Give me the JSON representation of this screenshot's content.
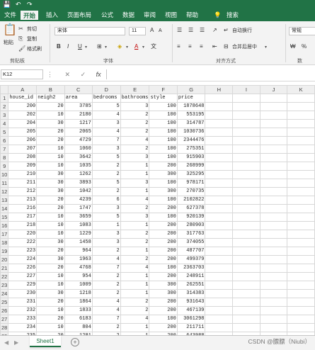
{
  "titlebar": {
    "save_icon": "💾",
    "undo_icon": "↶",
    "redo_icon": "↷"
  },
  "ribbon_tabs": [
    "文件",
    "开始",
    "插入",
    "页面布局",
    "公式",
    "数据",
    "审阅",
    "视图",
    "帮助"
  ],
  "active_tab": "开始",
  "tell_me": "搜索",
  "ribbon": {
    "clipboard": {
      "paste": "粘贴",
      "cut": "剪切",
      "copy": "复制",
      "format_painter": "格式刷",
      "label": "剪贴板"
    },
    "font": {
      "name": "宋体",
      "size": "11",
      "bold": "B",
      "italic": "I",
      "underline": "U",
      "label": "字体"
    },
    "alignment": {
      "wrap": "自动换行",
      "merge": "合并后居中",
      "label": "对齐方式"
    },
    "number": {
      "format": "常规",
      "label": "数"
    }
  },
  "formula_bar": {
    "name_box": "K12",
    "cancel": "✕",
    "enter": "✓",
    "fx": "fx",
    "value": ""
  },
  "columns": [
    "A",
    "B",
    "C",
    "D",
    "E",
    "F",
    "G",
    "H",
    "I",
    "J",
    "K"
  ],
  "header_row": [
    "house_id",
    "neigh2",
    "area",
    "bedrooms",
    "bathrooms",
    "style",
    "price"
  ],
  "rows": [
    [
      "200",
      "20",
      "3785",
      "5",
      "3",
      "100",
      "1878648"
    ],
    [
      "202",
      "10",
      "2180",
      "4",
      "2",
      "100",
      "553195"
    ],
    [
      "204",
      "30",
      "1217",
      "3",
      "2",
      "100",
      "314787"
    ],
    [
      "205",
      "20",
      "2065",
      "4",
      "2",
      "100",
      "1030736"
    ],
    [
      "206",
      "20",
      "4729",
      "7",
      "4",
      "100",
      "2344476"
    ],
    [
      "207",
      "10",
      "1060",
      "3",
      "2",
      "100",
      "275351"
    ],
    [
      "208",
      "10",
      "3642",
      "5",
      "3",
      "100",
      "915903"
    ],
    [
      "209",
      "10",
      "1035",
      "2",
      "1",
      "200",
      "268999"
    ],
    [
      "210",
      "30",
      "1262",
      "2",
      "1",
      "300",
      "325295"
    ],
    [
      "211",
      "30",
      "3893",
      "5",
      "3",
      "100",
      "978171"
    ],
    [
      "212",
      "30",
      "1042",
      "2",
      "1",
      "300",
      "270735"
    ],
    [
      "213",
      "20",
      "4239",
      "6",
      "4",
      "100",
      "2102822"
    ],
    [
      "216",
      "20",
      "1747",
      "3",
      "2",
      "200",
      "627378"
    ],
    [
      "217",
      "10",
      "3659",
      "5",
      "3",
      "100",
      "920139"
    ],
    [
      "218",
      "10",
      "1083",
      "1",
      "1",
      "200",
      "280903"
    ],
    [
      "220",
      "10",
      "1229",
      "3",
      "2",
      "200",
      "317763"
    ],
    [
      "222",
      "30",
      "1458",
      "3",
      "2",
      "200",
      "374055"
    ],
    [
      "223",
      "20",
      "964",
      "2",
      "1",
      "200",
      "487707"
    ],
    [
      "224",
      "30",
      "1963",
      "4",
      "2",
      "200",
      "499379"
    ],
    [
      "226",
      "20",
      "4768",
      "7",
      "4",
      "100",
      "2363703"
    ],
    [
      "227",
      "10",
      "954",
      "2",
      "1",
      "200",
      "248911"
    ],
    [
      "229",
      "10",
      "1009",
      "2",
      "1",
      "300",
      "262551"
    ],
    [
      "230",
      "30",
      "1218",
      "2",
      "1",
      "300",
      "314383"
    ],
    [
      "231",
      "20",
      "1864",
      "4",
      "2",
      "200",
      "931643"
    ],
    [
      "232",
      "10",
      "1833",
      "4",
      "2",
      "200",
      "467139"
    ],
    [
      "233",
      "20",
      "6183",
      "7",
      "4",
      "100",
      "3061298"
    ],
    [
      "234",
      "10",
      "804",
      "2",
      "1",
      "200",
      "211711"
    ],
    [
      "235",
      "20",
      "1281",
      "2",
      "1",
      "200",
      "643988"
    ]
  ],
  "sheet_tab": "Sheet1",
  "watermark": "CSDN @膘膘（Niubi）",
  "colors": {
    "brand": "#217346"
  }
}
